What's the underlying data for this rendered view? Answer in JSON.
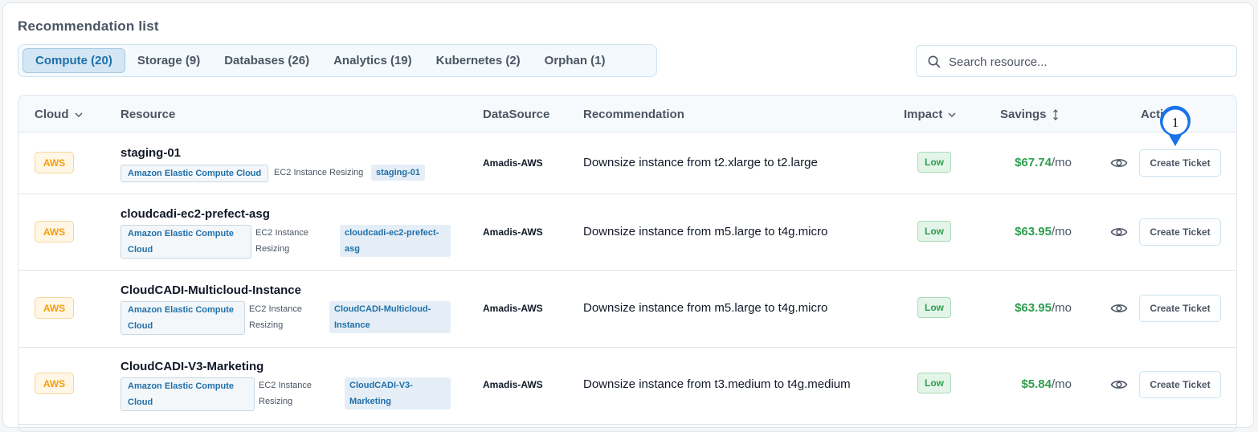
{
  "panel": {
    "title": "Recommendation list"
  },
  "tabs": [
    {
      "label": "Compute (20)",
      "active": true
    },
    {
      "label": "Storage (9)",
      "active": false
    },
    {
      "label": "Databases (26)",
      "active": false
    },
    {
      "label": "Analytics (19)",
      "active": false
    },
    {
      "label": "Kubernetes (2)",
      "active": false
    },
    {
      "label": "Orphan (1)",
      "active": false
    }
  ],
  "search": {
    "placeholder": "Search resource..."
  },
  "table": {
    "headers": {
      "cloud": "Cloud",
      "resource": "Resource",
      "datasource": "DataSource",
      "recommendation": "Recommendation",
      "impact": "Impact",
      "savings": "Savings",
      "action": "Action"
    },
    "rows": [
      {
        "cloud": "AWS",
        "name": "staging-01",
        "service": "Amazon Elastic Compute Cloud",
        "type": "EC2 Instance Resizing",
        "resource_id": "staging-01",
        "datasource": "Amadis-AWS",
        "recommendation": "Downsize instance from t2.xlarge to t2.large",
        "impact": "Low",
        "savings_amount": "$67.74",
        "savings_unit": "/mo",
        "action_label": "Create Ticket"
      },
      {
        "cloud": "AWS",
        "name": "cloudcadi-ec2-prefect-asg",
        "service": "Amazon Elastic Compute Cloud",
        "type": "EC2 Instance Resizing",
        "resource_id": "cloudcadi-ec2-prefect-asg",
        "datasource": "Amadis-AWS",
        "recommendation": "Downsize instance from m5.large to t4g.micro",
        "impact": "Low",
        "savings_amount": "$63.95",
        "savings_unit": "/mo",
        "action_label": "Create Ticket"
      },
      {
        "cloud": "AWS",
        "name": "CloudCADI-Multicloud-Instance",
        "service": "Amazon Elastic Compute Cloud",
        "type": "EC2 Instance Resizing",
        "resource_id": "CloudCADI-Multicloud-Instance",
        "datasource": "Amadis-AWS",
        "recommendation": "Downsize instance from m5.large to t4g.micro",
        "impact": "Low",
        "savings_amount": "$63.95",
        "savings_unit": "/mo",
        "action_label": "Create Ticket"
      },
      {
        "cloud": "AWS",
        "name": "CloudCADI-V3-Marketing",
        "service": "Amazon Elastic Compute Cloud",
        "type": "EC2 Instance Resizing",
        "resource_id": "CloudCADI-V3-Marketing",
        "datasource": "Amadis-AWS",
        "recommendation": "Downsize instance from t3.medium to t4g.medium",
        "impact": "Low",
        "savings_amount": "$5.84",
        "savings_unit": "/mo",
        "action_label": "Create Ticket"
      }
    ]
  },
  "callout": {
    "number": "1"
  },
  "colors": {
    "accent": "#1f6fa8",
    "aws_badge": "#f59e0b",
    "impact_low": "#2e9e4f",
    "savings": "#2e9e4f",
    "callout": "#1a73e8"
  }
}
